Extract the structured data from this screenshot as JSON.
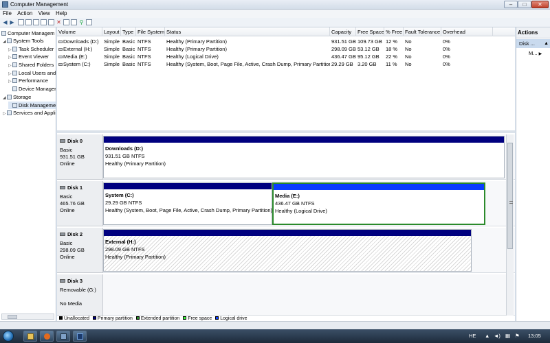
{
  "window": {
    "title": "Computer Management"
  },
  "menu": [
    "File",
    "Action",
    "View",
    "Help"
  ],
  "tree": [
    {
      "label": "Computer Managem",
      "indent": 0,
      "exp": ""
    },
    {
      "label": "System Tools",
      "indent": 1,
      "exp": "◢"
    },
    {
      "label": "Task Scheduler",
      "indent": 2,
      "exp": "▷"
    },
    {
      "label": "Event Viewer",
      "indent": 2,
      "exp": "▷"
    },
    {
      "label": "Shared Folders",
      "indent": 2,
      "exp": "▷"
    },
    {
      "label": "Local Users and",
      "indent": 2,
      "exp": "▷"
    },
    {
      "label": "Performance",
      "indent": 2,
      "exp": "▷"
    },
    {
      "label": "Device Manager",
      "indent": 2,
      "exp": ""
    },
    {
      "label": "Storage",
      "indent": 1,
      "exp": "◢"
    },
    {
      "label": "Disk Manageme",
      "indent": 2,
      "exp": "",
      "selected": true
    },
    {
      "label": "Services and Appli",
      "indent": 1,
      "exp": "▷"
    }
  ],
  "volume_table": {
    "columns": [
      "Volume",
      "Layout",
      "Type",
      "File System",
      "Status",
      "Capacity",
      "Free Space",
      "% Free",
      "Fault Tolerance",
      "Overhead"
    ],
    "rows": [
      [
        "Downloads (D:)",
        "Simple",
        "Basic",
        "NTFS",
        "Healthy (Primary Partition)",
        "931.51 GB",
        "109.73 GB",
        "12 %",
        "No",
        "0%"
      ],
      [
        "External (H:)",
        "Simple",
        "Basic",
        "NTFS",
        "Healthy (Primary Partition)",
        "298.09 GB",
        "53.12 GB",
        "18 %",
        "No",
        "0%"
      ],
      [
        "Media (E:)",
        "Simple",
        "Basic",
        "NTFS",
        "Healthy (Logical Drive)",
        "436.47 GB",
        "95.12 GB",
        "22 %",
        "No",
        "0%"
      ],
      [
        "System (C:)",
        "Simple",
        "Basic",
        "NTFS",
        "Healthy (System, Boot, Page File, Active, Crash Dump, Primary Partition)",
        "29.29 GB",
        "3.20 GB",
        "11 %",
        "No",
        "0%"
      ]
    ]
  },
  "disks": [
    {
      "name": "Disk 0",
      "type": "Basic",
      "size": "931.51 GB",
      "status": "Online",
      "partitions": [
        {
          "name": "Downloads  (D:)",
          "size": "931.51 GB NTFS",
          "status": "Healthy (Primary Partition)",
          "bar": "#00007f"
        }
      ]
    },
    {
      "name": "Disk 1",
      "type": "Basic",
      "size": "465.76 GB",
      "status": "Online",
      "partitions": [
        {
          "name": "System  (C:)",
          "size": "29.29 GB NTFS",
          "status": "Healthy (System, Boot, Page File, Active, Crash Dump, Primary Partition)",
          "bar": "#00007f"
        },
        {
          "name": "Media  (E:)",
          "size": "436.47 GB NTFS",
          "status": "Healthy (Logical Drive)",
          "bar": "#0a3dff"
        }
      ]
    },
    {
      "name": "Disk 2",
      "type": "Basic",
      "size": "298.09 GB",
      "status": "Online",
      "partitions": [
        {
          "name": "External  (H:)",
          "size": "298.09 GB NTFS",
          "status": "Healthy (Primary Partition)",
          "bar": "#00007f"
        }
      ]
    },
    {
      "name": "Disk 3",
      "type": "Removable (G:)",
      "size": "",
      "status": "No Media",
      "partitions": []
    }
  ],
  "legend": [
    {
      "label": "Unallocated",
      "color": "#000000"
    },
    {
      "label": "Primary partition",
      "color": "#00007f"
    },
    {
      "label": "Extended partition",
      "color": "#2b8a2b"
    },
    {
      "label": "Free space",
      "color": "#3cff3c"
    },
    {
      "label": "Logical drive",
      "color": "#0a3dff"
    }
  ],
  "actions": {
    "header": "Actions",
    "selected": "Disk ...",
    "more": "M..."
  },
  "taskbar": {
    "language": "HE",
    "clock": "13:05"
  }
}
